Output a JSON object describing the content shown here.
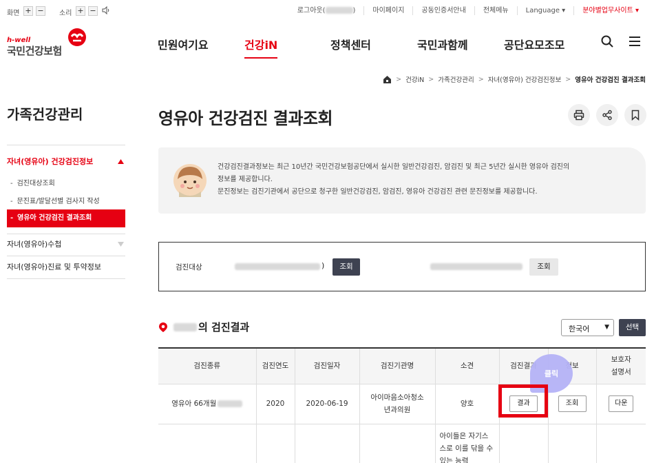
{
  "utility": {
    "screen_label": "화면",
    "sound_label": "소리",
    "plus": "+",
    "minus": "−",
    "links": [
      "로그아웃(",
      "마이페이지",
      "공동인증서안내",
      "전체메뉴",
      "Language ▾",
      "분야별업무사이트 ▾"
    ],
    "logout_suffix": ")"
  },
  "logo": {
    "tagline": "h-well",
    "name": "국민건강보험"
  },
  "gnb": [
    "민원여기요",
    "건강iN",
    "정책센터",
    "국민과함께",
    "공단요모조모"
  ],
  "breadcrumb": [
    "건강iN",
    "가족건강관리",
    "자녀(영유아) 건강검진정보",
    "영유아 건강검진 결과조회"
  ],
  "sidebar": {
    "title": "가족건강관리",
    "section1": "자녀(영유아) 건강검진정보",
    "items": [
      "검진대상조회",
      "문진표/발달선별 검사지 작성",
      "영유아 건강검진 결과조회"
    ],
    "section2": "자녀(영유아)수첩",
    "section3": "자녀(영유아)진료 및 투약정보",
    "dash": "-"
  },
  "page": {
    "title": "영유아 건강검진 결과조회",
    "notice_lines": [
      "건강검진결과정보는 최근 10년간 국민건강보험공단에서 실시한 일반건강검진, 암검진 및 최근 5년간 실시한 영유아 검진의",
      "정보를 제공합니다.",
      "문진정보는 검진기관에서 공단으로 청구한 일반건강검진, 암검진, 영유아 건강검진 관련 문진정보를 제공합니다."
    ],
    "search_label": "검진대상",
    "paren_close": ")",
    "lookup": "조회",
    "result_title_suffix": "의 검진결과",
    "language_value": "한국어",
    "select_button": "선택"
  },
  "table": {
    "headers": [
      "검진종류",
      "검진연도",
      "검진일자",
      "검진기관명",
      "소견",
      "검진결과",
      "정보",
      "보호자 설명서"
    ],
    "row1": {
      "type_prefix": "영유아 66개월",
      "year": "2020",
      "date": "2020-06-19",
      "clinic": "아이마음소아청소년과의원",
      "opinion": "양호",
      "result_btn": "결과",
      "lookup_btn": "조회",
      "download_btn": "다운"
    },
    "row2": {
      "opinion": "아이들은 자기스스로 이를 닦을 수 있는 능력"
    }
  },
  "overlay": {
    "bubble": "클릭"
  },
  "colors": {
    "brand_red": "#e60012",
    "dark_button": "#3e4251",
    "bubble": "#b5b3f7"
  }
}
